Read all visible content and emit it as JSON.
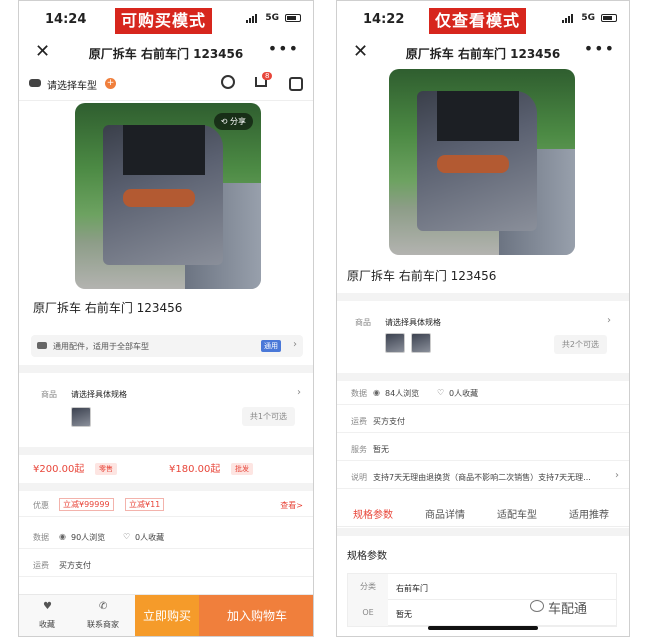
{
  "left": {
    "status_time": "14:24",
    "status_net": "5G",
    "mode_badge": "可购买模式",
    "nav_title": "原厂拆车 右前车门 123456",
    "select_model": "请选择车型",
    "cart_badge": "8",
    "share_label": "分享",
    "product_title": "原厂拆车 右前车门 123456",
    "fit_text": "通用配件，适用于全部车型",
    "fit_tag": "通用",
    "spec_label": "商品",
    "spec_text": "请选择具体规格",
    "spec_available": "共1个可选",
    "price_retail": "¥200.00起",
    "tag_retail": "零售",
    "price_wholesale": "¥180.00起",
    "tag_wholesale": "批发",
    "promo_label": "优惠",
    "coupon1": "立减¥99999",
    "coupon2": "立减¥11",
    "view_link": "查看>",
    "data_label": "数据",
    "views": "90人浏览",
    "favs": "0人收藏",
    "freight_label": "运费",
    "freight_value": "买方支付",
    "fav_btn": "收藏",
    "contact_btn": "联系商家",
    "buy_btn": "立即购买",
    "cart_btn": "加入购物车"
  },
  "right": {
    "status_time": "14:22",
    "status_net": "5G",
    "mode_badge": "仅查看模式",
    "nav_title": "原厂拆车 右前车门 123456",
    "product_title": "原厂拆车 右前车门 123456",
    "spec_label": "商品",
    "spec_text": "请选择具体规格",
    "spec_available": "共2个可选",
    "data_label": "数据",
    "views": "84人浏览",
    "favs": "0人收藏",
    "freight_label": "运费",
    "freight_value": "买方支付",
    "service_label": "服务",
    "service_value": "暂无",
    "desc_label": "说明",
    "desc_value": "支持7天无理由退换货（商品不影响二次销售）支持7天无理...",
    "tabs": [
      "规格参数",
      "商品详情",
      "适配车型",
      "适用推荐"
    ],
    "params_title": "规格参数",
    "param_rows": [
      {
        "k": "分类",
        "v": "右前车门"
      },
      {
        "k": "OE",
        "v": "暂无"
      }
    ]
  },
  "watermark": "车配通",
  "colors": {
    "accent": "#e8463a",
    "badge": "#d7261d",
    "buy": "#f59b2a",
    "cart": "#f07f3c"
  },
  "icons": [
    "close-icon",
    "more-icon",
    "car-icon",
    "plus-icon",
    "search-icon",
    "cart-icon",
    "home-icon",
    "share-icon",
    "eye-icon",
    "heart-icon",
    "phone-icon",
    "chevron-right-icon"
  ]
}
